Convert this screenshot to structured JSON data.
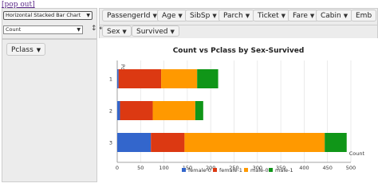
{
  "popout_link": "[pop out]",
  "renderer": {
    "selected": "Horizontal Stacked Bar Chart"
  },
  "aggregator": {
    "selected": "Count"
  },
  "cols_attrs": [
    {
      "label": "PassengerId"
    },
    {
      "label": "Age"
    },
    {
      "label": "SibSp"
    },
    {
      "label": "Parch"
    },
    {
      "label": "Ticket"
    },
    {
      "label": "Fare"
    },
    {
      "label": "Cabin"
    },
    {
      "label": "Emb"
    }
  ],
  "col_fields": [
    {
      "label": "Sex"
    },
    {
      "label": "Survived"
    }
  ],
  "row_fields": [
    {
      "label": "Pclass"
    }
  ],
  "colors": {
    "female-0": "#3366cc",
    "female-1": "#dc3912",
    "male-0": "#ff9900",
    "male-1": "#109618"
  },
  "chart_data": {
    "type": "bar",
    "orientation": "horizontal",
    "stacked": true,
    "title": "Count vs Pclass by Sex-Survived",
    "ylabel": "Pclass",
    "xlabel": "Count",
    "categories": [
      "1",
      "2",
      "3"
    ],
    "series": [
      {
        "name": "female-0",
        "values": [
          3,
          6,
          72
        ]
      },
      {
        "name": "female-1",
        "values": [
          91,
          70,
          72
        ]
      },
      {
        "name": "male-0",
        "values": [
          77,
          91,
          300
        ]
      },
      {
        "name": "male-1",
        "values": [
          45,
          17,
          47
        ]
      }
    ],
    "xticks": [
      "0",
      "50",
      "100",
      "150",
      "200",
      "250",
      "300",
      "350",
      "400",
      "450",
      "500"
    ],
    "xlim": [
      0,
      500
    ],
    "grid": true,
    "legend": "bottom"
  }
}
